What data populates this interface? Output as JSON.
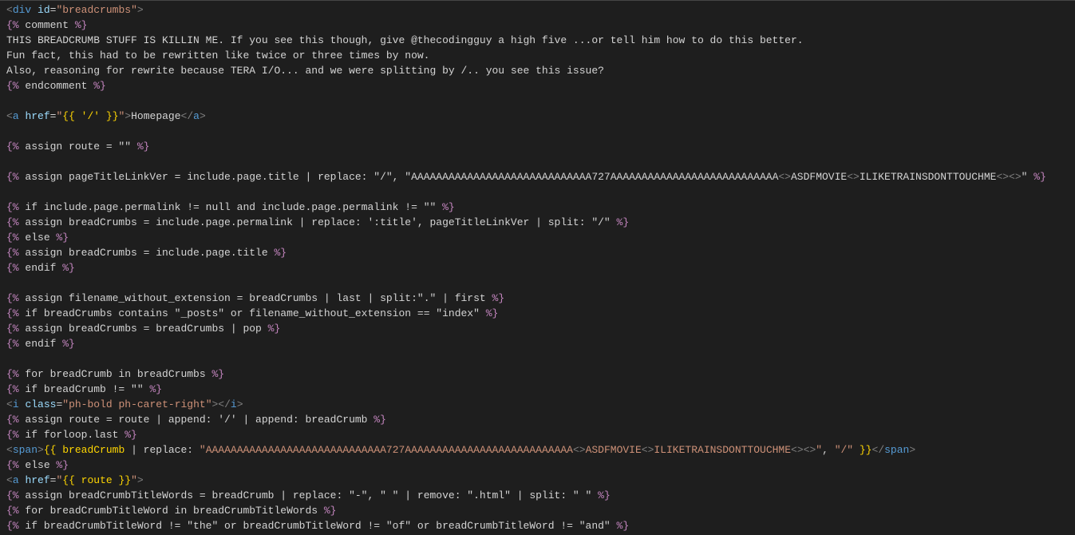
{
  "code": {
    "lines": [
      [
        {
          "cls": "tag-bracket",
          "t": "<"
        },
        {
          "cls": "tag-name",
          "t": "div"
        },
        {
          "cls": "plaintext",
          "t": " "
        },
        {
          "cls": "attr-name",
          "t": "id"
        },
        {
          "cls": "plaintext",
          "t": "="
        },
        {
          "cls": "attr-value",
          "t": "\"breadcrumbs\""
        },
        {
          "cls": "tag-bracket",
          "t": ">"
        }
      ],
      [
        {
          "cls": "liquid-delim",
          "t": "{%"
        },
        {
          "cls": "liquid-text",
          "t": " comment "
        },
        {
          "cls": "liquid-delim",
          "t": "%}"
        }
      ],
      [
        {
          "cls": "plaintext",
          "t": "THIS BREADCRUMB STUFF IS KILLIN ME. If you see this though, give @thecodingguy a high five ...or tell him how to do this better."
        }
      ],
      [
        {
          "cls": "plaintext",
          "t": "Fun fact, this had to be rewritten like twice or three times by now."
        }
      ],
      [
        {
          "cls": "plaintext",
          "t": "Also, reasoning for rewrite because TERA I/O... and we were splitting by /.. you see this issue?"
        }
      ],
      [
        {
          "cls": "liquid-delim",
          "t": "{%"
        },
        {
          "cls": "liquid-text",
          "t": " endcomment "
        },
        {
          "cls": "liquid-delim",
          "t": "%}"
        }
      ],
      [],
      [
        {
          "cls": "tag-bracket",
          "t": "<"
        },
        {
          "cls": "tag-name",
          "t": "a"
        },
        {
          "cls": "plaintext",
          "t": " "
        },
        {
          "cls": "attr-name",
          "t": "href"
        },
        {
          "cls": "plaintext",
          "t": "="
        },
        {
          "cls": "attr-value",
          "t": "\""
        },
        {
          "cls": "curly",
          "t": "{{ '/' }}"
        },
        {
          "cls": "attr-value",
          "t": "\""
        },
        {
          "cls": "tag-bracket",
          "t": ">"
        },
        {
          "cls": "plaintext",
          "t": "Homepage"
        },
        {
          "cls": "tag-bracket",
          "t": "</"
        },
        {
          "cls": "tag-name",
          "t": "a"
        },
        {
          "cls": "tag-bracket",
          "t": ">"
        }
      ],
      [],
      [
        {
          "cls": "liquid-delim",
          "t": "{%"
        },
        {
          "cls": "liquid-text",
          "t": " assign route = \"\" "
        },
        {
          "cls": "liquid-delim",
          "t": "%}"
        }
      ],
      [],
      [
        {
          "cls": "liquid-delim",
          "t": "{%"
        },
        {
          "cls": "liquid-text",
          "t": " assign pageTitleLinkVer = include.page.title | replace: \"/\", \"AAAAAAAAAAAAAAAAAAAAAAAAAAAAA727AAAAAAAAAAAAAAAAAAAAAAAAAAA"
        },
        {
          "cls": "tag-bracket",
          "t": "<>"
        },
        {
          "cls": "liquid-text",
          "t": "ASDFMOVIE"
        },
        {
          "cls": "tag-bracket",
          "t": "<>"
        },
        {
          "cls": "liquid-text",
          "t": "ILIKETRAINSDONTTOUCHME"
        },
        {
          "cls": "tag-bracket",
          "t": "<><>"
        },
        {
          "cls": "liquid-text",
          "t": "\" "
        },
        {
          "cls": "liquid-delim",
          "t": "%}"
        }
      ],
      [],
      [
        {
          "cls": "liquid-delim",
          "t": "{%"
        },
        {
          "cls": "liquid-text",
          "t": " if include.page.permalink != null and include.page.permalink != \"\" "
        },
        {
          "cls": "liquid-delim",
          "t": "%}"
        }
      ],
      [
        {
          "cls": "liquid-delim",
          "t": "{%"
        },
        {
          "cls": "liquid-text",
          "t": " assign breadCrumbs = include.page.permalink | replace: ':title', pageTitleLinkVer | split: \"/\" "
        },
        {
          "cls": "liquid-delim",
          "t": "%}"
        }
      ],
      [
        {
          "cls": "liquid-delim",
          "t": "{%"
        },
        {
          "cls": "liquid-text",
          "t": " else "
        },
        {
          "cls": "liquid-delim",
          "t": "%}"
        }
      ],
      [
        {
          "cls": "liquid-delim",
          "t": "{%"
        },
        {
          "cls": "liquid-text",
          "t": " assign breadCrumbs = include.page.title "
        },
        {
          "cls": "liquid-delim",
          "t": "%}"
        }
      ],
      [
        {
          "cls": "liquid-delim",
          "t": "{%"
        },
        {
          "cls": "liquid-text",
          "t": " endif "
        },
        {
          "cls": "liquid-delim",
          "t": "%}"
        }
      ],
      [],
      [
        {
          "cls": "liquid-delim",
          "t": "{%"
        },
        {
          "cls": "liquid-text",
          "t": " assign filename_without_extension = breadCrumbs | last | split:\".\" | first "
        },
        {
          "cls": "liquid-delim",
          "t": "%}"
        }
      ],
      [
        {
          "cls": "liquid-delim",
          "t": "{%"
        },
        {
          "cls": "liquid-text",
          "t": " if breadCrumbs contains \"_posts\" or filename_without_extension == \"index\" "
        },
        {
          "cls": "liquid-delim",
          "t": "%}"
        }
      ],
      [
        {
          "cls": "liquid-delim",
          "t": "{%"
        },
        {
          "cls": "liquid-text",
          "t": " assign breadCrumbs = breadCrumbs | pop "
        },
        {
          "cls": "liquid-delim",
          "t": "%}"
        }
      ],
      [
        {
          "cls": "liquid-delim",
          "t": "{%"
        },
        {
          "cls": "liquid-text",
          "t": " endif "
        },
        {
          "cls": "liquid-delim",
          "t": "%}"
        }
      ],
      [],
      [
        {
          "cls": "liquid-delim",
          "t": "{%"
        },
        {
          "cls": "liquid-text",
          "t": " for breadCrumb in breadCrumbs "
        },
        {
          "cls": "liquid-delim",
          "t": "%}"
        }
      ],
      [
        {
          "cls": "liquid-delim",
          "t": "{%"
        },
        {
          "cls": "liquid-text",
          "t": " if breadCrumb != \"\" "
        },
        {
          "cls": "liquid-delim",
          "t": "%}"
        }
      ],
      [
        {
          "cls": "tag-bracket",
          "t": "<"
        },
        {
          "cls": "tag-name",
          "t": "i"
        },
        {
          "cls": "plaintext",
          "t": " "
        },
        {
          "cls": "attr-name",
          "t": "class"
        },
        {
          "cls": "plaintext",
          "t": "="
        },
        {
          "cls": "attr-value",
          "t": "\"ph-bold ph-caret-right\""
        },
        {
          "cls": "tag-bracket",
          "t": "></"
        },
        {
          "cls": "tag-name",
          "t": "i"
        },
        {
          "cls": "tag-bracket",
          "t": ">"
        }
      ],
      [
        {
          "cls": "liquid-delim",
          "t": "{%"
        },
        {
          "cls": "liquid-text",
          "t": " assign route = route | append: '/' | append: breadCrumb "
        },
        {
          "cls": "liquid-delim",
          "t": "%}"
        }
      ],
      [
        {
          "cls": "liquid-delim",
          "t": "{%"
        },
        {
          "cls": "liquid-text",
          "t": " if forloop.last "
        },
        {
          "cls": "liquid-delim",
          "t": "%}"
        }
      ],
      [
        {
          "cls": "tag-bracket",
          "t": "<"
        },
        {
          "cls": "tag-name",
          "t": "span"
        },
        {
          "cls": "tag-bracket",
          "t": ">"
        },
        {
          "cls": "curly",
          "t": "{{ breadCrumb"
        },
        {
          "cls": "plaintext",
          "t": " | replace: "
        },
        {
          "cls": "liquid-string",
          "t": "\"AAAAAAAAAAAAAAAAAAAAAAAAAAAAA727AAAAAAAAAAAAAAAAAAAAAAAAAAA"
        },
        {
          "cls": "tag-bracket",
          "t": "<>"
        },
        {
          "cls": "liquid-string",
          "t": "ASDFMOVIE"
        },
        {
          "cls": "tag-bracket",
          "t": "<>"
        },
        {
          "cls": "liquid-string",
          "t": "ILIKETRAINSDONTTOUCHME"
        },
        {
          "cls": "tag-bracket",
          "t": "<><>"
        },
        {
          "cls": "liquid-string",
          "t": "\""
        },
        {
          "cls": "plaintext",
          "t": ", "
        },
        {
          "cls": "liquid-string",
          "t": "\"/\""
        },
        {
          "cls": "plaintext",
          "t": " "
        },
        {
          "cls": "curly",
          "t": "}}"
        },
        {
          "cls": "tag-bracket",
          "t": "</"
        },
        {
          "cls": "tag-name",
          "t": "span"
        },
        {
          "cls": "tag-bracket",
          "t": ">"
        }
      ],
      [
        {
          "cls": "liquid-delim",
          "t": "{%"
        },
        {
          "cls": "liquid-text",
          "t": " else "
        },
        {
          "cls": "liquid-delim",
          "t": "%}"
        }
      ],
      [
        {
          "cls": "tag-bracket",
          "t": "<"
        },
        {
          "cls": "tag-name",
          "t": "a"
        },
        {
          "cls": "plaintext",
          "t": " "
        },
        {
          "cls": "attr-name",
          "t": "href"
        },
        {
          "cls": "plaintext",
          "t": "="
        },
        {
          "cls": "attr-value",
          "t": "\""
        },
        {
          "cls": "curly",
          "t": "{{ route }}"
        },
        {
          "cls": "attr-value",
          "t": "\""
        },
        {
          "cls": "tag-bracket",
          "t": ">"
        }
      ],
      [
        {
          "cls": "liquid-delim",
          "t": "{%"
        },
        {
          "cls": "liquid-text",
          "t": " assign breadCrumbTitleWords = breadCrumb | replace: \"-\", \" \" | remove: \".html\" | split: \" \" "
        },
        {
          "cls": "liquid-delim",
          "t": "%}"
        }
      ],
      [
        {
          "cls": "liquid-delim",
          "t": "{%"
        },
        {
          "cls": "liquid-text",
          "t": " for breadCrumbTitleWord in breadCrumbTitleWords "
        },
        {
          "cls": "liquid-delim",
          "t": "%}"
        }
      ],
      [
        {
          "cls": "liquid-delim",
          "t": "{%"
        },
        {
          "cls": "liquid-text",
          "t": " if breadCrumbTitleWord != \"the\" or breadCrumbTitleWord != \"of\" or breadCrumbTitleWord != \"and\" "
        },
        {
          "cls": "liquid-delim",
          "t": "%}"
        }
      ]
    ]
  }
}
